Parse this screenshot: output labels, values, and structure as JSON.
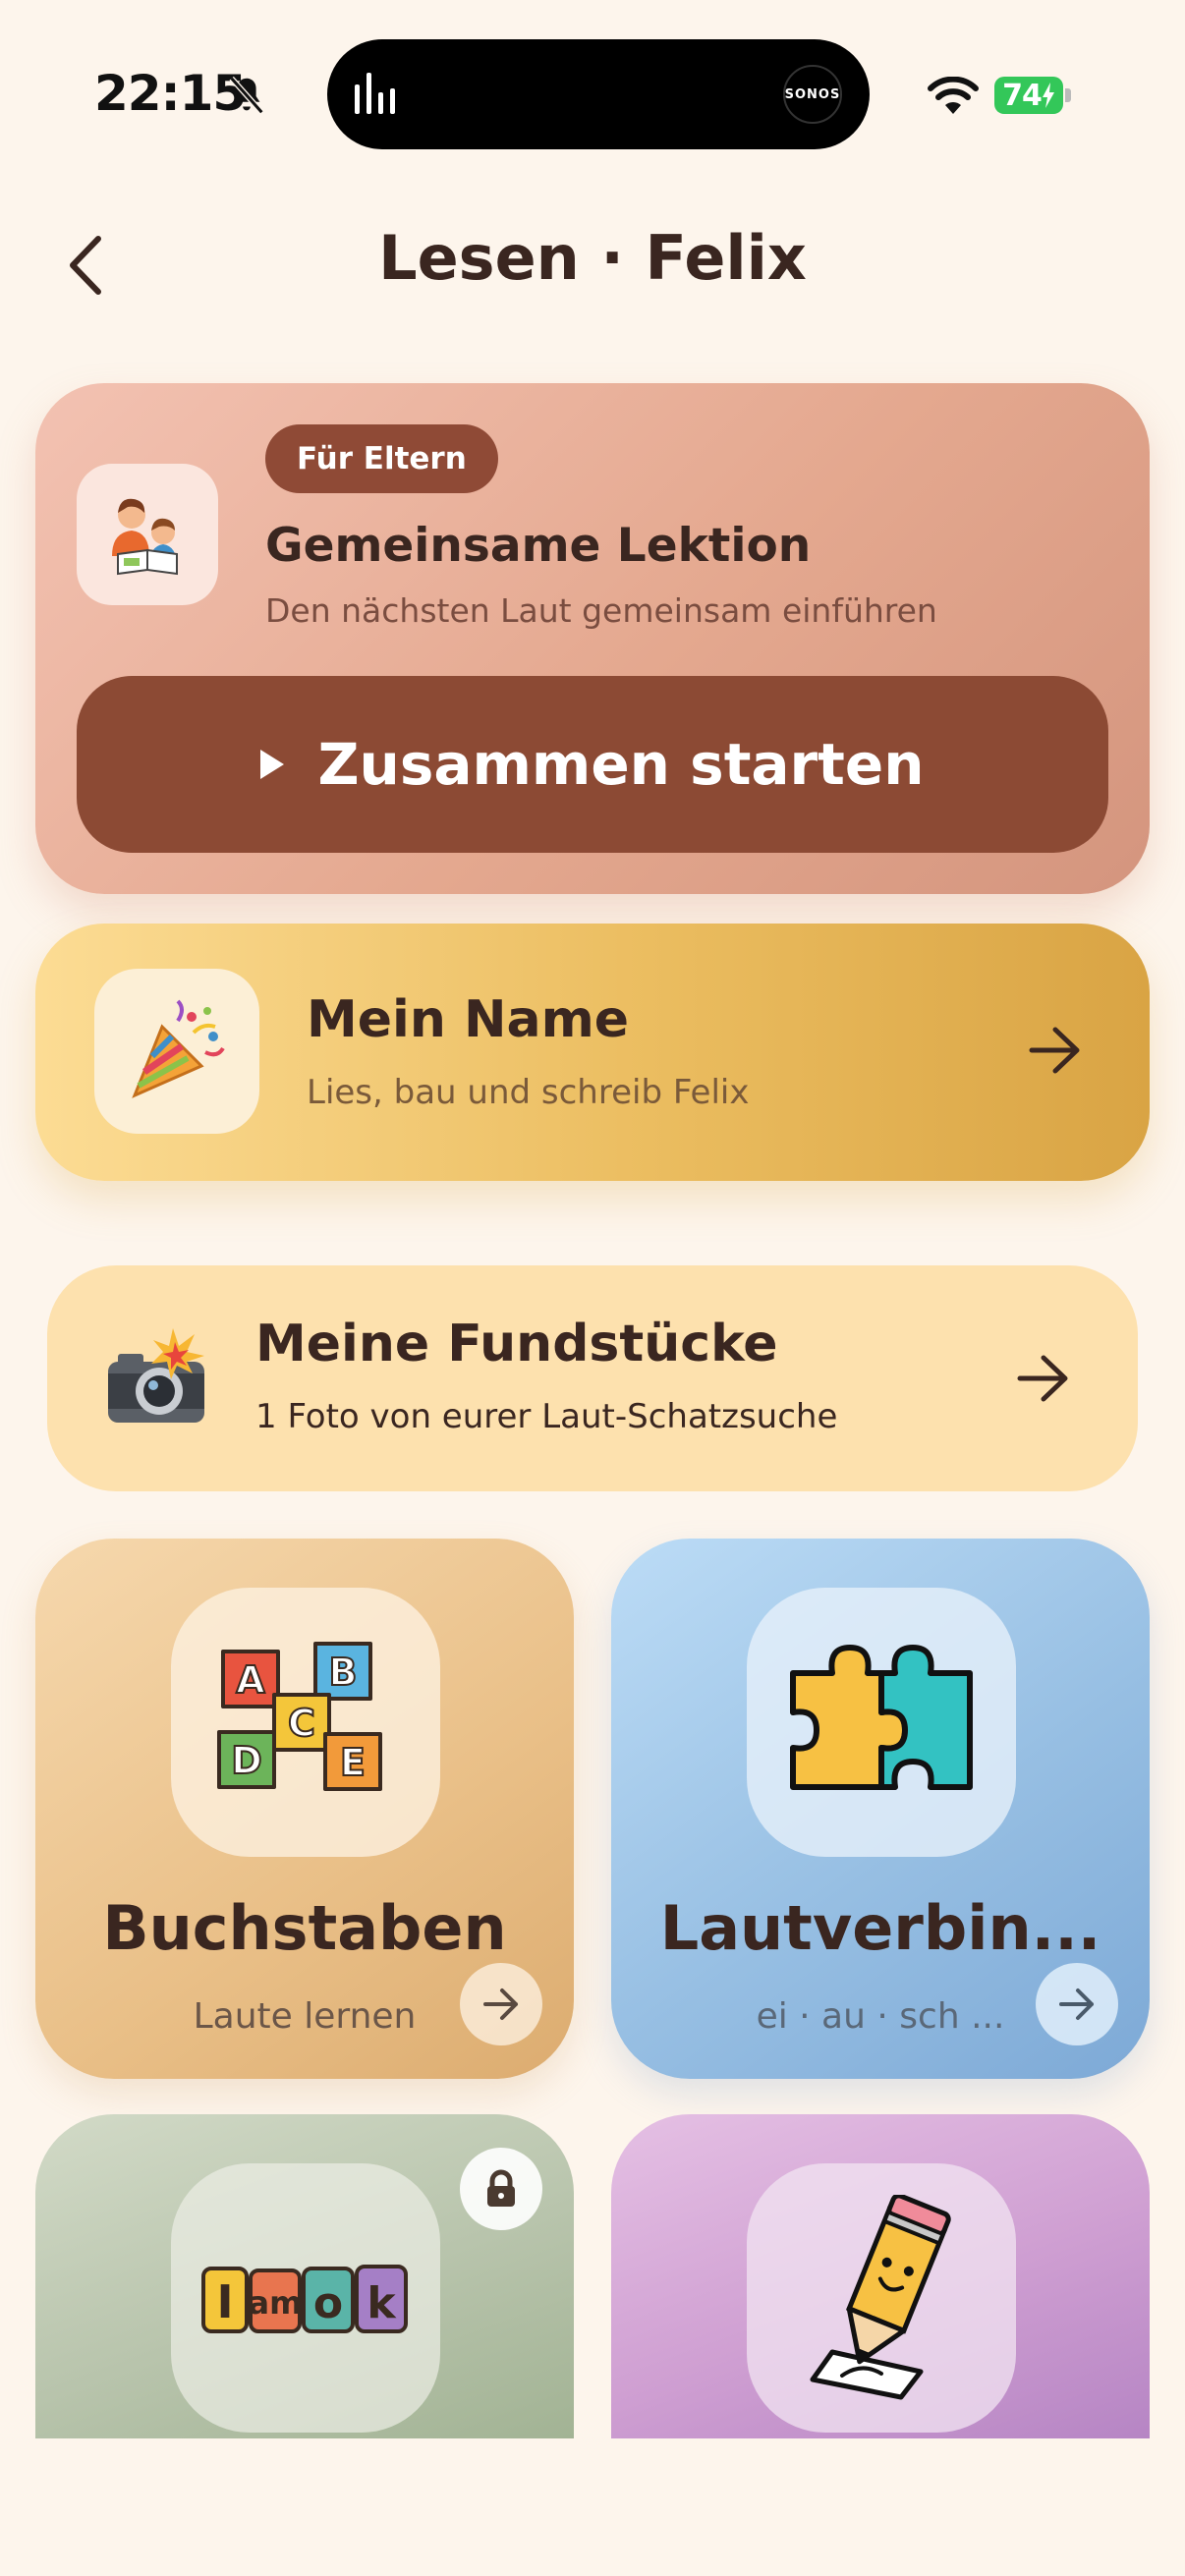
{
  "status_bar": {
    "time": "22:15",
    "battery": "74",
    "island_label": "SONOS"
  },
  "header": {
    "title": "Lesen · Felix"
  },
  "parent_card": {
    "badge": "Für Eltern",
    "title": "Gemeinsame Lektion",
    "subtitle": "Den nächsten Laut gemeinsam einführen",
    "button_label": "Zusammen starten"
  },
  "name_card": {
    "title": "Mein Name",
    "subtitle": "Lies, bau und schreib Felix"
  },
  "finds_card": {
    "title": "Meine Fundstücke",
    "subtitle": "1 Foto von eurer Laut-Schatzsuche"
  },
  "tiles": [
    {
      "title": "Buchstaben",
      "subtitle": "Laute lernen"
    },
    {
      "title": "Lautverbin...",
      "subtitle": "ei · au · sch ..."
    }
  ],
  "colors": {
    "background": "#fdf5ec",
    "parent_button": "#8c4a34",
    "badge": "#8f4a36",
    "battery": "#33c759"
  }
}
